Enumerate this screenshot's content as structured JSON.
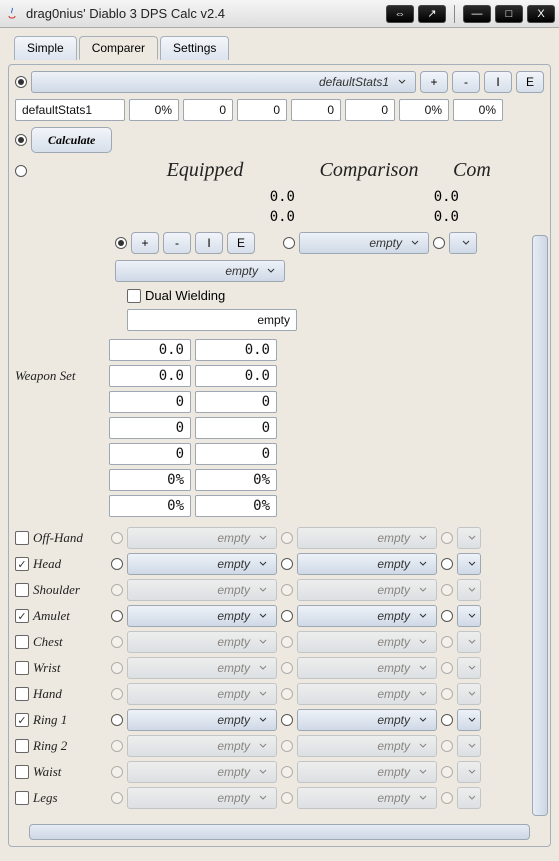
{
  "window": {
    "title": "drag0nius' Diablo 3 DPS Calc v2.4"
  },
  "tabs": {
    "simple": "Simple",
    "comparer": "Comparer",
    "settings": "Settings"
  },
  "topbar": {
    "profile_combo": "defaultStats1",
    "btn_plus": "+",
    "btn_minus": "-",
    "btn_i": "I",
    "btn_e": "E",
    "profile_input": "defaultStats1",
    "pct0": "0%",
    "v1": "0",
    "v2": "0",
    "v3": "0",
    "v4": "0",
    "pct1": "0%",
    "pct2": "0%"
  },
  "calculate": "Calculate",
  "headers": {
    "equipped": "Equipped",
    "comparison": "Comparison",
    "com_cut": "Com"
  },
  "totals": {
    "eq_a": "0.0",
    "eq_b": "0.0",
    "cmp_a": "0.0",
    "cmp_b": "0.0"
  },
  "equipped_bar": {
    "plus": "+",
    "minus": "-",
    "i": "I",
    "e": "E",
    "combo": "empty"
  },
  "cmp_combo": "empty",
  "dual_wielding_label": "Dual Wielding",
  "weapon": {
    "label": "Weapon Set",
    "name": "empty",
    "r1a": "0.0",
    "r1b": "0.0",
    "r2a": "0.0",
    "r2b": "0.0",
    "r3a": "0",
    "r3b": "0",
    "r4a": "0",
    "r4b": "0",
    "r5a": "0",
    "r5b": "0",
    "r6a": "0%",
    "r6b": "0%",
    "r7a": "0%",
    "r7b": "0%"
  },
  "slots": [
    {
      "name": "Off-Hand",
      "checked": false,
      "eq": "empty",
      "c1": "empty"
    },
    {
      "name": "Head",
      "checked": true,
      "eq": "empty",
      "c1": "empty"
    },
    {
      "name": "Shoulder",
      "checked": false,
      "eq": "empty",
      "c1": "empty"
    },
    {
      "name": "Amulet",
      "checked": true,
      "eq": "empty",
      "c1": "empty"
    },
    {
      "name": "Chest",
      "checked": false,
      "eq": "empty",
      "c1": "empty"
    },
    {
      "name": "Wrist",
      "checked": false,
      "eq": "empty",
      "c1": "empty"
    },
    {
      "name": "Hand",
      "checked": false,
      "eq": "empty",
      "c1": "empty"
    },
    {
      "name": "Ring 1",
      "checked": true,
      "eq": "empty",
      "c1": "empty"
    },
    {
      "name": "Ring 2",
      "checked": false,
      "eq": "empty",
      "c1": "empty"
    },
    {
      "name": "Waist",
      "checked": false,
      "eq": "empty",
      "c1": "empty"
    },
    {
      "name": "Legs",
      "checked": false,
      "eq": "empty",
      "c1": "empty"
    }
  ]
}
